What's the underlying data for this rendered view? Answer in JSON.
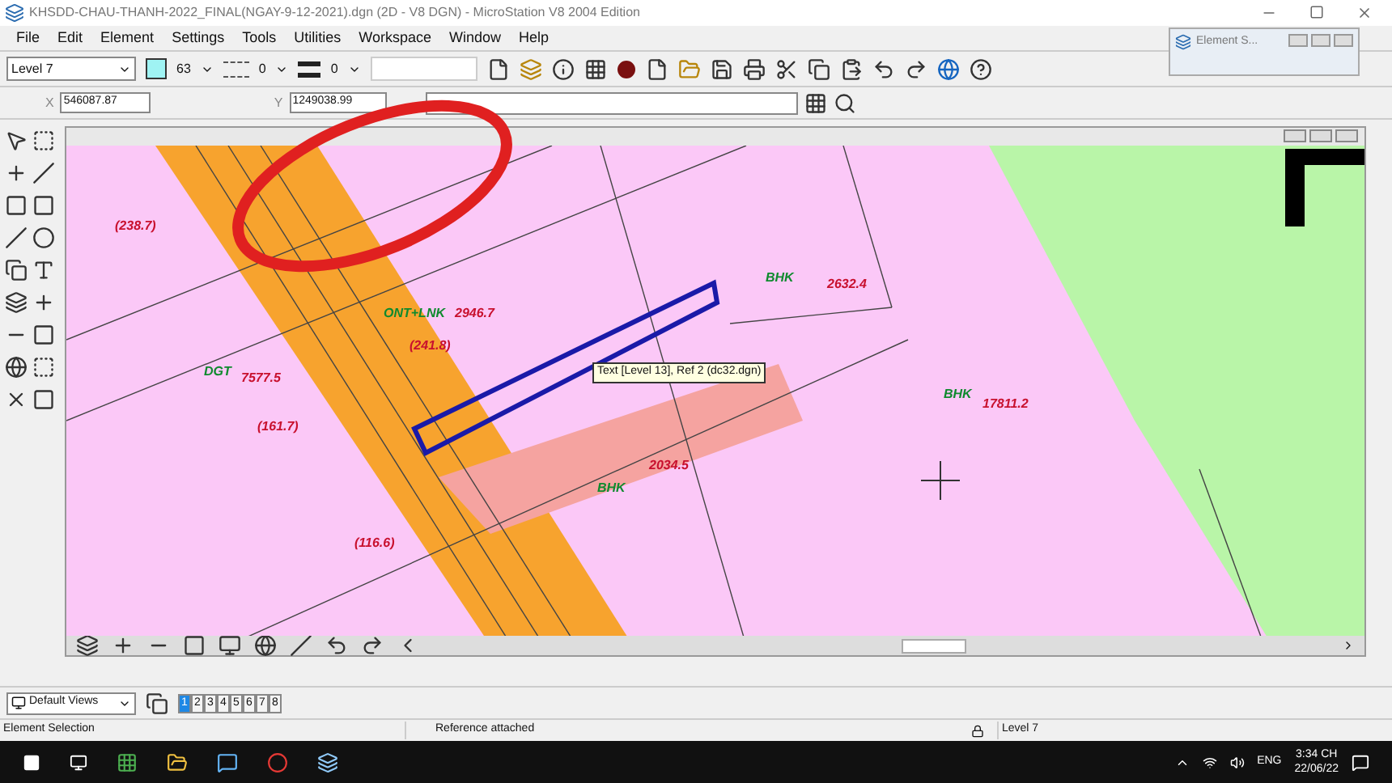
{
  "window": {
    "title": "KHSDD-CHAU-THANH-2022_FINAL(NGAY-9-12-2021).dgn (2D - V8 DGN) - MicroStation V8 2004 Edition"
  },
  "menu": [
    "File",
    "Edit",
    "Element",
    "Settings",
    "Tools",
    "Utilities",
    "Workspace",
    "Window",
    "Help"
  ],
  "toolbar": {
    "level": "Level 7",
    "color_index": "63",
    "style": "0",
    "weight": "0"
  },
  "coordinates": {
    "x_label": "X",
    "x_value": "546087.87",
    "y_label": "Y",
    "y_value": "1249038.99"
  },
  "element_dialog": {
    "title": "Element S..."
  },
  "map": {
    "labels": [
      {
        "text": "(238.7)",
        "kind": "area"
      },
      {
        "text": "ONT+LNK",
        "kind": "code"
      },
      {
        "text": "2946.7",
        "kind": "area"
      },
      {
        "text": "(241.8)",
        "kind": "area"
      },
      {
        "text": "DGT",
        "kind": "code"
      },
      {
        "text": "7577.5",
        "kind": "area"
      },
      {
        "text": "BHK",
        "kind": "code"
      },
      {
        "text": "2632.4",
        "kind": "area"
      },
      {
        "text": "BHK",
        "kind": "code"
      },
      {
        "text": "17811.2",
        "kind": "area"
      },
      {
        "text": "BHK",
        "kind": "code"
      },
      {
        "text": "2034.5",
        "kind": "area"
      },
      {
        "text": "(161.7)",
        "kind": "area"
      },
      {
        "text": "(116.6)",
        "kind": "area"
      }
    ],
    "tooltip": "Text [Level 13], Ref 2 (dc32.dgn)"
  },
  "views_bar": {
    "preset": "Default Views",
    "views": [
      {
        "label": "1",
        "selected": true
      },
      {
        "label": "2",
        "selected": false
      },
      {
        "label": "3",
        "selected": false
      },
      {
        "label": "4",
        "selected": false
      },
      {
        "label": "5",
        "selected": false
      },
      {
        "label": "6",
        "selected": false
      },
      {
        "label": "7",
        "selected": false
      },
      {
        "label": "8",
        "selected": false
      }
    ]
  },
  "status_bar": {
    "prompt": "Element Selection",
    "message": "Reference attached",
    "level": "Level 7"
  },
  "taskbar": {
    "language": "ENG",
    "time": "3:34 CH",
    "date": "22/06/22"
  }
}
